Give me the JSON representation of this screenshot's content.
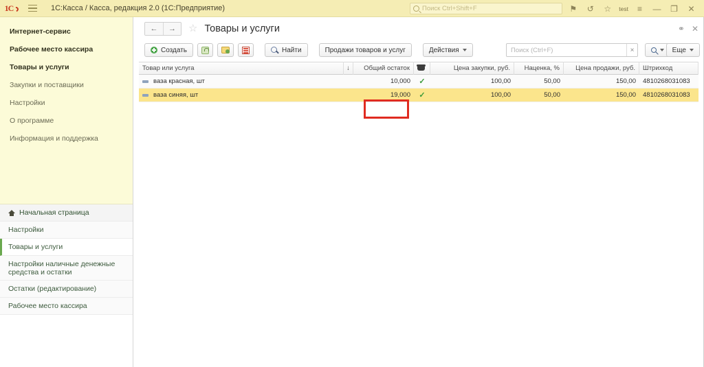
{
  "titlebar": {
    "logo": "1C",
    "menu_icon": "hamburger-menu-icon",
    "app_title": "1С:Касса / Касса, редакция 2.0  (1С:Предприятие)",
    "search_placeholder": "Поиск Ctrl+Shift+F",
    "icons": [
      {
        "name": "bell-icon",
        "glyph": "⚑"
      },
      {
        "name": "history-icon",
        "glyph": "↺"
      },
      {
        "name": "favorites-star-icon",
        "glyph": "☆"
      }
    ],
    "user_label": "test",
    "menu_lines_icon": "menu-lines-icon",
    "minimize": "—",
    "maximize": "❐",
    "close": "✕"
  },
  "sidebar": {
    "top_items": [
      {
        "label": "Интернет-сервис",
        "style": "bold"
      },
      {
        "label": "Рабочее место кассира",
        "style": "bold"
      },
      {
        "label": "Товары и услуги",
        "style": "bold"
      },
      {
        "label": "Закупки и поставщики",
        "style": "muted"
      },
      {
        "label": "Настройки",
        "style": "muted"
      },
      {
        "label": "О программе",
        "style": "muted"
      },
      {
        "label": "Информация и поддержка",
        "style": "muted"
      }
    ],
    "bottom_items": [
      {
        "label": "Начальная страница",
        "icon": "home-icon",
        "state": "home"
      },
      {
        "label": "Настройки",
        "state": "normal"
      },
      {
        "label": "Товары и услуги",
        "state": "active"
      },
      {
        "label": "Настройки наличные денежные",
        "label2": "средства и остатки",
        "state": "normal"
      },
      {
        "label": "Остатки (редактирование)",
        "state": "normal"
      },
      {
        "label": "Рабочее место кассира",
        "state": "normal"
      }
    ]
  },
  "main": {
    "nav_back": "←",
    "nav_forward": "→",
    "favorite_star": "☆",
    "page_title": "Товары и услуги",
    "link_icon": "⚭",
    "close_icon": "✕"
  },
  "toolbar": {
    "create_label": "Создать",
    "lock_icon": "lock-product-icon",
    "folder_icon": "new-folder-icon",
    "report_icon": "report-icon",
    "find_label": "Найти",
    "sales_label": "Продажи товаров и услуг",
    "actions_label": "Действия",
    "search_placeholder": "Поиск (Ctrl+F)",
    "search_clear": "×",
    "more_label": "Еще"
  },
  "table": {
    "columns": [
      {
        "key": "name",
        "label": "Товар или услуга",
        "align": "left"
      },
      {
        "key": "sort",
        "label": "↓",
        "align": "center"
      },
      {
        "key": "stock",
        "label": "Общий остаток",
        "align": "right"
      },
      {
        "key": "mark",
        "label": "",
        "icon": "marking-icon",
        "align": "center"
      },
      {
        "key": "buy",
        "label": "Цена закупки, руб.",
        "align": "right"
      },
      {
        "key": "marg",
        "label": "Наценка, %",
        "align": "right"
      },
      {
        "key": "sell",
        "label": "Цена продажи, руб.",
        "align": "right"
      },
      {
        "key": "bar",
        "label": "Штрихкод",
        "align": "left"
      }
    ],
    "rows": [
      {
        "name": "ваза красная, шт",
        "stock": "10,000",
        "check": "✓",
        "buy": "100,00",
        "marg": "50,00",
        "sell": "150,00",
        "bar": "4810268031083",
        "selected": false
      },
      {
        "name": "ваза синяя, шт",
        "stock": "19,000",
        "check": "✓",
        "buy": "100,00",
        "marg": "50,00",
        "sell": "150,00",
        "bar": "4810268031083",
        "selected": true
      }
    ]
  },
  "annotation": {
    "name": "highlight-box",
    "color": "#e02b20",
    "target_text": "19,000"
  }
}
